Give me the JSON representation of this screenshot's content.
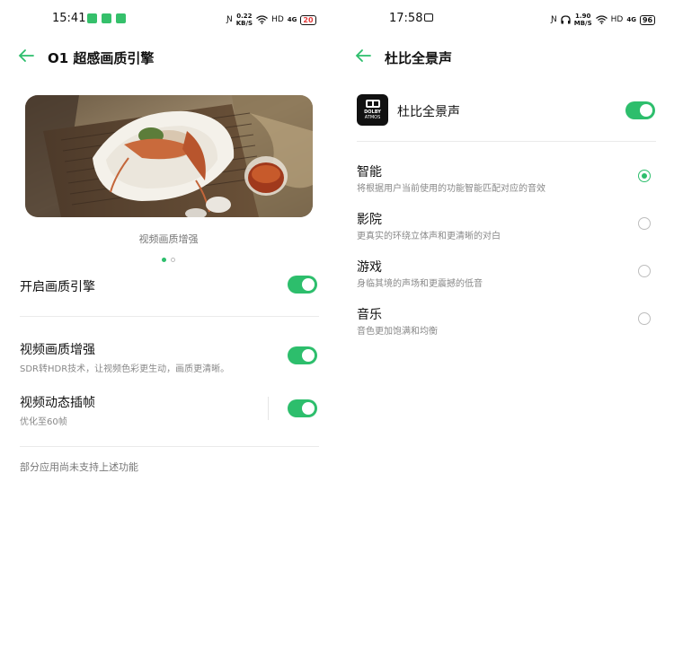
{
  "left": {
    "status": {
      "time": "15:41",
      "speed_top": "0.22",
      "speed_unit": "KB/S",
      "hd": "HD",
      "signal": "4G",
      "battery": "20"
    },
    "header": {
      "title": "O1 超感画质引擎"
    },
    "preview": {
      "caption": "视频画质增强"
    },
    "rows": {
      "engine": {
        "title": "开启画质引擎",
        "enabled": true
      },
      "enhance": {
        "title": "视频画质增强",
        "subtitle": "SDR转HDR技术，让视频色彩更生动，画质更清晰。",
        "enabled": true
      },
      "interp": {
        "title": "视频动态插帧",
        "subtitle": "优化至60帧",
        "enabled": true
      }
    },
    "note": "部分应用尚未支持上述功能"
  },
  "right": {
    "status": {
      "time": "17:58",
      "speed_top": "1.90",
      "speed_unit": "MB/S",
      "hd": "HD",
      "signal": "4G",
      "battery": "96"
    },
    "header": {
      "title": "杜比全景声"
    },
    "dolby": {
      "label": "杜比全景声",
      "logo_line1": "DOLBY",
      "logo_line2": "ATMOS",
      "enabled": true
    },
    "modes": [
      {
        "title": "智能",
        "subtitle": "将根据用户当前使用的功能智能匹配对应的音效",
        "selected": true
      },
      {
        "title": "影院",
        "subtitle": "更真实的环绕立体声和更清晰的对白",
        "selected": false
      },
      {
        "title": "游戏",
        "subtitle": "身临其境的声场和更震撼的低音",
        "selected": false
      },
      {
        "title": "音乐",
        "subtitle": "音色更加饱满和均衡",
        "selected": false
      }
    ]
  },
  "colors": {
    "accent": "#2dbe6c",
    "text": "#111111",
    "subtext": "#888888"
  }
}
